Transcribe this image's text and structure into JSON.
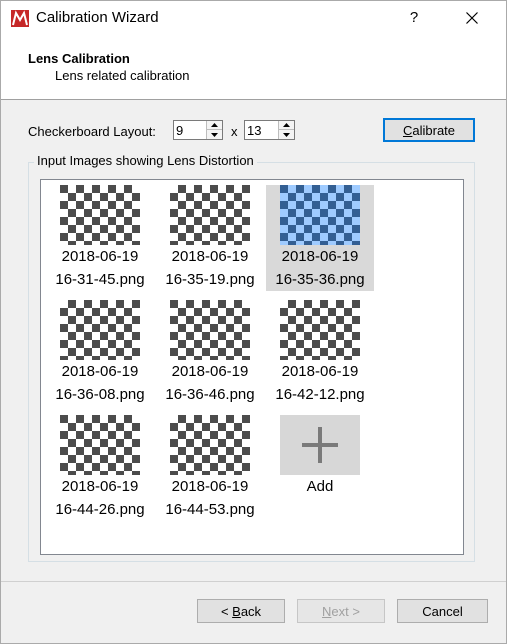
{
  "window": {
    "title": "Calibration Wizard",
    "help_label": "?"
  },
  "header": {
    "title": "Lens Calibration",
    "subtitle": "Lens related calibration"
  },
  "layout": {
    "label": "Checkerboard Layout:",
    "cols": "9",
    "rows": "13",
    "separator": "x"
  },
  "calibrate_button": {
    "label_first": "C",
    "label_rest": "alibrate"
  },
  "group": {
    "label": "Input Images showing Lens Distortion"
  },
  "images": [
    {
      "date": "2018-06-19",
      "file": "16-31-45.png"
    },
    {
      "date": "2018-06-19",
      "file": "16-35-19.png"
    },
    {
      "date": "2018-06-19",
      "file": "16-35-36.png",
      "selected": true
    },
    {
      "date": "2018-06-19",
      "file": "16-36-08.png"
    },
    {
      "date": "2018-06-19",
      "file": "16-36-46.png"
    },
    {
      "date": "2018-06-19",
      "file": "16-42-12.png"
    },
    {
      "date": "2018-06-19",
      "file": "16-44-26.png"
    },
    {
      "date": "2018-06-19",
      "file": "16-44-53.png"
    }
  ],
  "add_tile": {
    "label": "Add",
    "icon": "plus-icon"
  },
  "footer": {
    "back_arrow": "<",
    "back_first": "B",
    "back_rest": "ack",
    "next_first": "N",
    "next_rest": "ext",
    "next_arrow": ">",
    "cancel": "Cancel"
  },
  "colors": {
    "accent": "#0078d7",
    "selection": "#d9d9d9",
    "brand": "#c62828"
  }
}
